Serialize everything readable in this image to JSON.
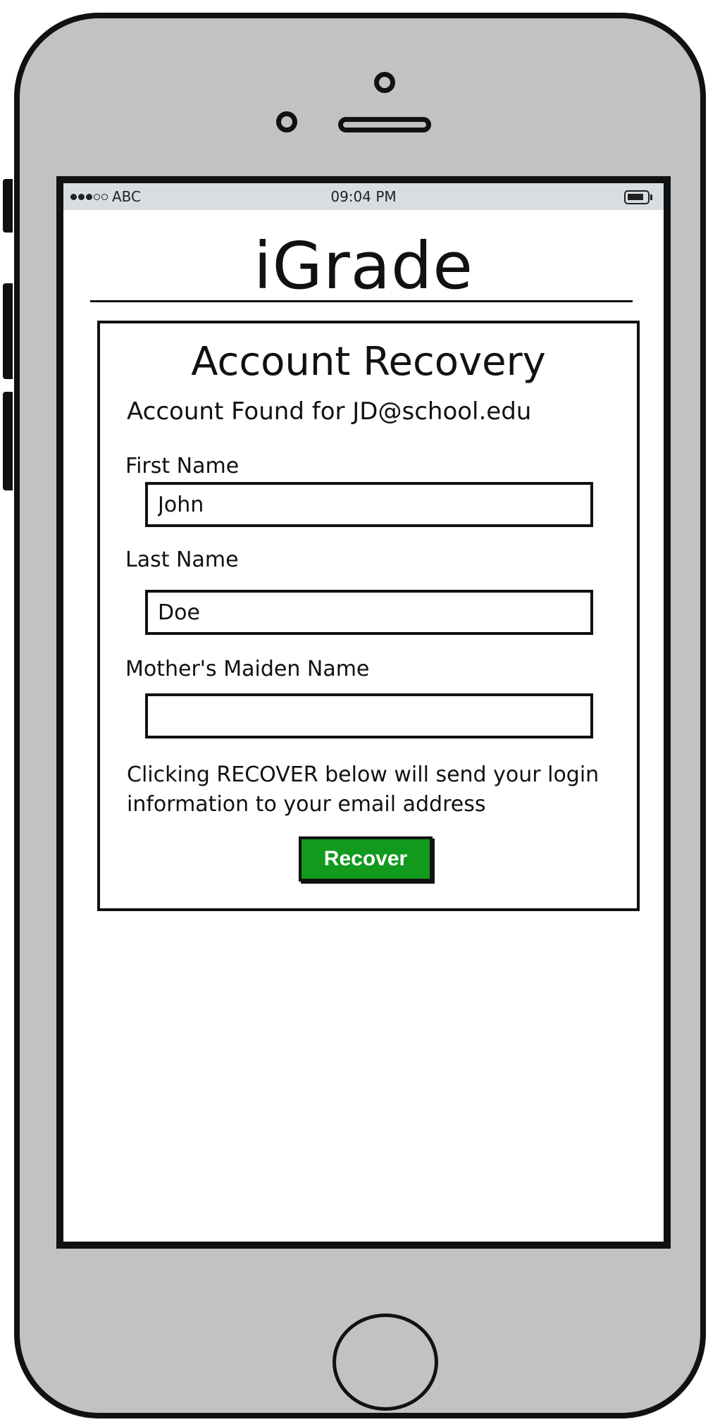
{
  "status_bar": {
    "carrier": "ABC",
    "time": "09:04 PM"
  },
  "app": {
    "title": "iGrade"
  },
  "recovery": {
    "title": "Account Recovery",
    "found_text": "Account Found for JD@school.edu",
    "fields": [
      {
        "label": "First Name",
        "value": "John"
      },
      {
        "label": "Last Name",
        "value": "Doe"
      },
      {
        "label": "Mother's Maiden Name",
        "value": ""
      }
    ],
    "notice": "Clicking RECOVER below will send your login information to your email address",
    "button_label": "Recover"
  },
  "colors": {
    "button_green": "#119a1d",
    "device_gray": "#c2c2c2",
    "status_bar_bg": "#d8dde1"
  }
}
